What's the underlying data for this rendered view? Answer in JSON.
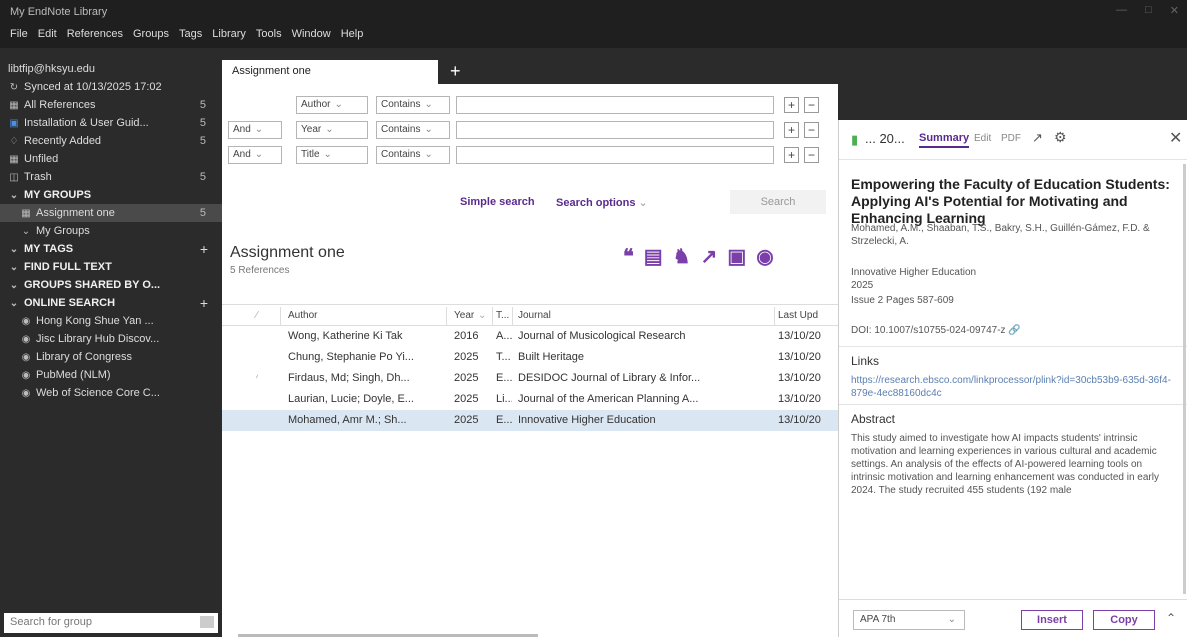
{
  "window": {
    "title": "My EndNote Library"
  },
  "menu": [
    "File",
    "Edit",
    "References",
    "Groups",
    "Tags",
    "Library",
    "Tools",
    "Window",
    "Help"
  ],
  "sidebar": {
    "account": "libtfip@hksyu.edu",
    "synced": "Synced at 10/13/2025 17:02",
    "items": [
      {
        "label": "All References",
        "count": "5"
      },
      {
        "label": "Installation & User Guid...",
        "count": "5"
      },
      {
        "label": "Recently Added",
        "count": "5"
      },
      {
        "label": "Unfiled",
        "count": ""
      },
      {
        "label": "Trash",
        "count": "5"
      }
    ],
    "my_groups": "MY GROUPS",
    "group_items": [
      {
        "label": "Assignment one",
        "count": "5"
      },
      {
        "label": "My Groups",
        "count": ""
      }
    ],
    "my_tags": "MY TAGS",
    "find_full_text": "FIND FULL TEXT",
    "groups_shared": "GROUPS SHARED BY O...",
    "online_search": "ONLINE SEARCH",
    "online_items": [
      "Hong Kong Shue Yan ...",
      "Jisc Library Hub Discov...",
      "Library of Congress",
      "PubMed (NLM)",
      "Web of Science Core C..."
    ],
    "search_placeholder": "Search for group"
  },
  "tabs": {
    "active": "Assignment one"
  },
  "search": {
    "rows": [
      {
        "bool": "",
        "field": "Author",
        "op": "Contains"
      },
      {
        "bool": "And",
        "field": "Year",
        "op": "Contains"
      },
      {
        "bool": "And",
        "field": "Title",
        "op": "Contains"
      }
    ],
    "simple_search": "Simple search",
    "search_options": "Search options",
    "search_button": "Search"
  },
  "group": {
    "title": "Assignment one",
    "count": "5 References"
  },
  "table": {
    "headers": [
      "Author",
      "Year",
      "T...",
      "Journal",
      "Last Upd"
    ],
    "rows": [
      {
        "author": "Wong, Katherine Ki Tak",
        "year": "2016",
        "type": "A...",
        "journal": "Journal of Musicological Research",
        "updated": "13/10/20",
        "attach": false,
        "selected": false
      },
      {
        "author": "Chung, Stephanie Po Yi...",
        "year": "2025",
        "type": "T...",
        "journal": "Built Heritage",
        "updated": "13/10/20",
        "attach": false,
        "selected": false
      },
      {
        "author": "Firdaus, Md; Singh, Dh...",
        "year": "2025",
        "type": "E...",
        "journal": "DESIDOC Journal of Library & Infor...",
        "updated": "13/10/20",
        "attach": true,
        "selected": false
      },
      {
        "author": "Laurian, Lucie; Doyle, E...",
        "year": "2025",
        "type": "Li...",
        "journal": "Journal of the American Planning A...",
        "updated": "13/10/20",
        "attach": false,
        "selected": false
      },
      {
        "author": "Mohamed, Amr M.; Sh...",
        "year": "2025",
        "type": "E...",
        "journal": "Innovative Higher Education",
        "updated": "13/10/20",
        "attach": false,
        "selected": true
      }
    ]
  },
  "panel": {
    "ref_label": "... 20...",
    "tab_summary": "Summary",
    "tab_edit": "Edit",
    "tab_pdf": "PDF",
    "title": "Empowering the Faculty of Education Students: Applying AI's Potential for Motivating and Enhancing Learning",
    "authors": "Mohamed, A.M., Shaaban, T.S., Bakry, S.H., Guillén-Gámez, F.D. & Strzelecki, A.",
    "journal": "Innovative Higher Education",
    "year": "2025",
    "issue_pages": "Issue 2    Pages 587-609",
    "doi": "DOI: 10.1007/s10755-024-09747-z",
    "links_heading": "Links",
    "link_url": "https://research.ebsco.com/linkprocessor/plink?id=30cb53b9-635d-36f4-879e-4ec88160dc4c",
    "abstract_heading": "Abstract",
    "abstract": "This study aimed to investigate how AI impacts students' intrinsic motivation and learning experiences in various cultural and academic settings. An analysis of the effects of AI-powered learning tools on intrinsic motivation and learning enhancement was conducted in early 2024. The study recruited 455 students (192 male",
    "style": "APA 7th",
    "insert": "Insert",
    "copy": "Copy"
  }
}
